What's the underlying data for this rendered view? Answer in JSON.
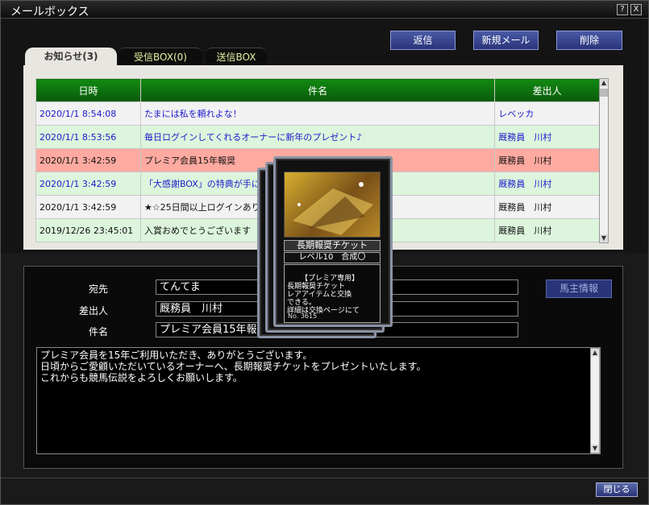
{
  "window": {
    "title": "メールボックス",
    "help_label": "?",
    "close_label": "X"
  },
  "toolbar": {
    "reply_label": "返信",
    "new_mail_label": "新規メール",
    "delete_label": "削除"
  },
  "tabs": [
    {
      "label": "お知らせ(3)",
      "active": true
    },
    {
      "label": "受信BOX(0)",
      "active": false
    },
    {
      "label": "送信BOX",
      "active": false
    }
  ],
  "table": {
    "columns": [
      "日時",
      "件名",
      "差出人"
    ],
    "rows": [
      {
        "date": "2020/1/1 8:54:08",
        "subject": "たまには私を頼れよな！",
        "sender": "レベッカ"
      },
      {
        "date": "2020/1/1 8:53:56",
        "subject": "毎日ログインしてくれるオーナーに新年のプレゼント♪",
        "sender": "厩務員　川村"
      },
      {
        "date": "2020/1/1 3:42:59",
        "subject": "プレミア会員15年報奨",
        "sender": "厩務員　川村"
      },
      {
        "date": "2020/1/1 3:42:59",
        "subject": "「大感謝BOX」の特典が手に入りました",
        "sender": "厩務員　川村"
      },
      {
        "date": "2020/1/1 3:42:59",
        "subject": "★☆25日間以上ログインありがとうございます☆★",
        "sender": "厩務員　川村"
      },
      {
        "date": "2019/12/26 23:45:01",
        "subject": "入賞おめでとうございます",
        "sender": "厩務員　川村"
      }
    ]
  },
  "detail": {
    "to_label": "宛先",
    "to_value": "てんてま",
    "from_label": "差出人",
    "from_value": "厩務員　川村",
    "subject_label": "件名",
    "subject_value": "プレミア会員15年報奨",
    "owner_info_label": "馬主情報",
    "body": "プレミア会員を15年ご利用いただき、ありがとうございます。\n日頃からご愛顧いただいているオーナーへ、長期報奨チケットをプレゼントいたします。\nこれからも競馬伝説をよろしくお願いします。"
  },
  "card": {
    "name": "長期報奨チケット",
    "level": "レベル10　合成〇",
    "description": "【プレミア専用】\n長期報奨チケット\nレアアイテムと交換\nできる。\n詳細は交換ページにて",
    "number": "No. 3615"
  },
  "footer": {
    "close_label": "閉じる"
  },
  "colors": {
    "table_header": "#128a12",
    "row_selected": "#ffaaa0",
    "row_green": "#dcf5dc",
    "link_blue": "#1a1acc",
    "button_blue": "#3a46a0"
  }
}
